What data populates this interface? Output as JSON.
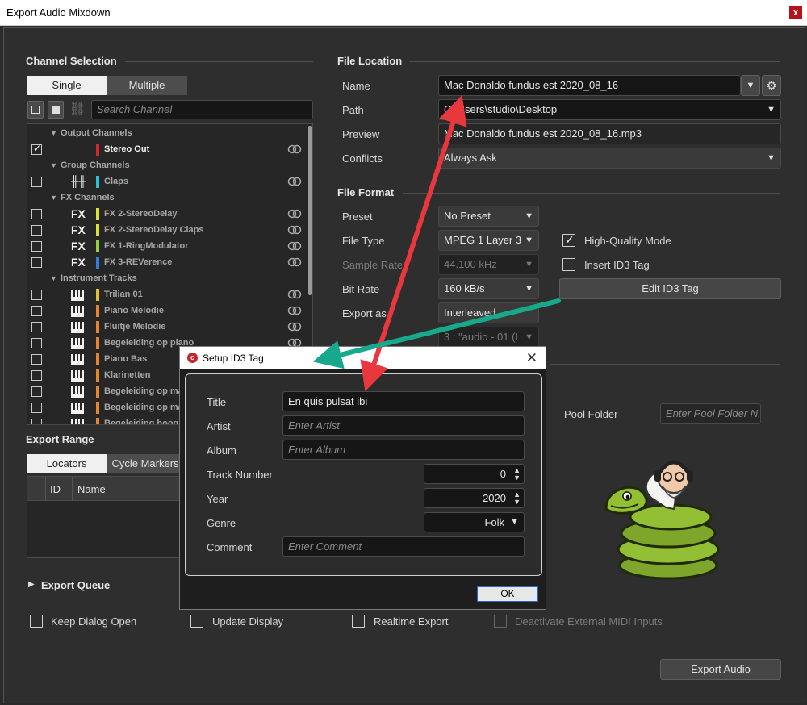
{
  "window": {
    "title": "Export Audio Mixdown",
    "close": "x"
  },
  "channel_selection": {
    "title": "Channel Selection",
    "mode_single": "Single",
    "mode_multiple": "Multiple",
    "search_placeholder": "Search Channel",
    "rows": [
      {
        "type": "group",
        "label": "Output Channels"
      },
      {
        "type": "item",
        "checked": true,
        "icon": "",
        "color": "#d8262d",
        "label": "Stereo Out",
        "selected": true
      },
      {
        "type": "group",
        "label": "Group Channels"
      },
      {
        "type": "item",
        "checked": false,
        "icon": "mixer-icon",
        "color": "#2bc1d2",
        "label": "Claps"
      },
      {
        "type": "group",
        "label": "FX Channels"
      },
      {
        "type": "item",
        "checked": false,
        "icon": "FX",
        "color": "#dfe22a",
        "label": "FX 2-StereoDelay"
      },
      {
        "type": "item",
        "checked": false,
        "icon": "FX",
        "color": "#dfe22a",
        "label": "FX 2-StereoDelay Claps"
      },
      {
        "type": "item",
        "checked": false,
        "icon": "FX",
        "color": "#95d13a",
        "label": "FX 1-RingModulator"
      },
      {
        "type": "item",
        "checked": false,
        "icon": "FX",
        "color": "#2f7fd6",
        "label": "FX 3-REVerence"
      },
      {
        "type": "group",
        "label": "Instrument Tracks"
      },
      {
        "type": "item",
        "checked": false,
        "icon": "piano-icon",
        "color": "#e2c22a",
        "label": "Trilian 01"
      },
      {
        "type": "item",
        "checked": false,
        "icon": "piano-icon",
        "color": "#e7852a",
        "label": "Piano Melodie"
      },
      {
        "type": "item",
        "checked": false,
        "icon": "piano-icon",
        "color": "#e7852a",
        "label": "Fluitje Melodie"
      },
      {
        "type": "item",
        "checked": false,
        "icon": "piano-icon",
        "color": "#e7852a",
        "label": "Begeleiding op piano"
      },
      {
        "type": "item",
        "checked": false,
        "icon": "piano-icon",
        "color": "#e7852a",
        "label": "Piano Bas"
      },
      {
        "type": "item",
        "checked": false,
        "icon": "piano-icon",
        "color": "#e7852a",
        "label": "Klarinetten"
      },
      {
        "type": "item",
        "checked": false,
        "icon": "piano-icon",
        "color": "#e7852a",
        "label": "Begeleiding op ma"
      },
      {
        "type": "item",
        "checked": false,
        "icon": "piano-icon",
        "color": "#e7852a",
        "label": "Begeleiding op ma"
      },
      {
        "type": "item",
        "checked": false,
        "icon": "piano-icon",
        "color": "#e7852a",
        "label": "Begeleiding hoog"
      }
    ]
  },
  "export_range": {
    "title": "Export Range",
    "tab_locators": "Locators",
    "tab_cycle": "Cycle Markers",
    "col_id": "ID",
    "col_name": "Name"
  },
  "file_location": {
    "title": "File Location",
    "name_label": "Name",
    "name_value": "Mac Donaldo fundus est 2020_08_16",
    "path_label": "Path",
    "path_value": "C:\\Users\\studio\\Desktop",
    "preview_label": "Preview",
    "preview_value": "Mac Donaldo fundus est 2020_08_16.mp3",
    "conflicts_label": "Conflicts",
    "conflicts_value": "Always Ask"
  },
  "file_format": {
    "title": "File Format",
    "preset_label": "Preset",
    "preset_value": "No Preset",
    "filetype_label": "File Type",
    "filetype_value": "MPEG 1 Layer 3",
    "samplerate_label": "Sample Rate",
    "samplerate_value": "44.100 kHz",
    "bitrate_label": "Bit Rate",
    "bitrate_value": "160 kB/s",
    "exportas_label": "Export as",
    "exportas_value": "Interleaved",
    "extra_value": "3 : \"audio - 01 (L",
    "hq_label": "High-Quality Mode",
    "id3_label": "Insert ID3 Tag",
    "edit_id3": "Edit ID3 Tag"
  },
  "pool": {
    "label": "Pool Folder",
    "placeholder": "Enter Pool Folder N."
  },
  "export_queue": {
    "title": "Export Queue"
  },
  "options": {
    "keep_open": "Keep Dialog Open",
    "update_display": "Update Display",
    "realtime": "Realtime Export",
    "deactivate_midi": "Deactivate External MIDI Inputs"
  },
  "export_button": "Export Audio",
  "id3_dialog": {
    "title": "Setup ID3 Tag",
    "close": "✕",
    "title_label": "Title",
    "title_value": "En quis pulsat ibi",
    "artist_label": "Artist",
    "artist_placeholder": "Enter Artist",
    "album_label": "Album",
    "album_placeholder": "Enter Album",
    "track_label": "Track Number",
    "track_value": "0",
    "year_label": "Year",
    "year_value": "2020",
    "genre_label": "Genre",
    "genre_value": "Folk",
    "comment_label": "Comment",
    "comment_placeholder": "Enter Comment",
    "ok": "OK"
  },
  "colors": {
    "arrow_red": "#e8373d",
    "arrow_teal": "#18a88c",
    "accent": "#2a66c7"
  }
}
